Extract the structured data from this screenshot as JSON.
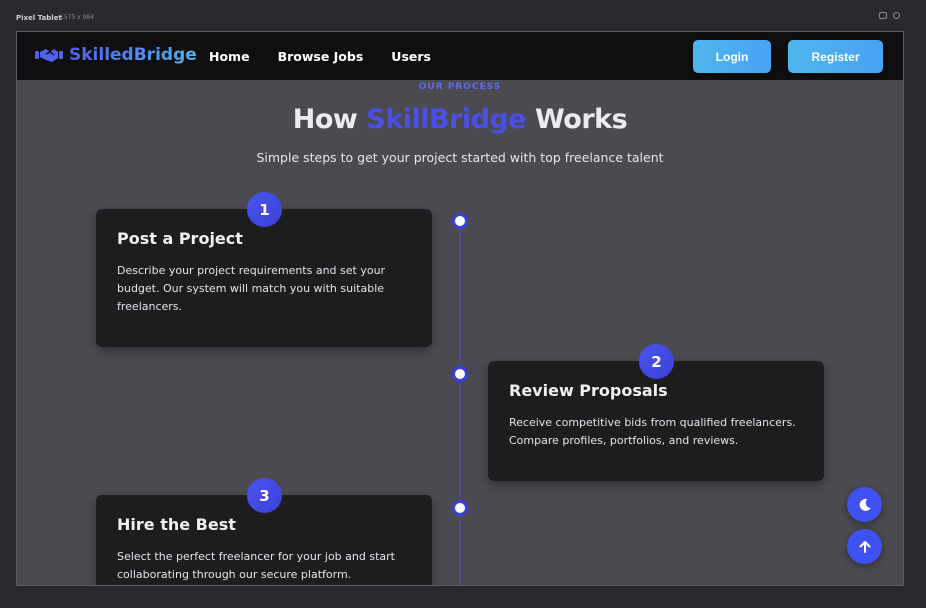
{
  "device": {
    "name": "Pixel Tablet",
    "dims": "1575 x 984"
  },
  "nav": {
    "logo_text": "SkilledBridge",
    "links": [
      "Home",
      "Browse Jobs",
      "Users"
    ],
    "login_label": "Login",
    "register_label": "Register"
  },
  "section": {
    "eyebrow": "OUR PROCESS",
    "title_prefix": "How",
    "title_accent": "SkillBridge",
    "title_suffix": "Works",
    "subtitle": "Simple steps to get your project started with top freelance talent"
  },
  "steps": [
    {
      "number": "1",
      "title": "Post a Project",
      "text": "Describe your project requirements and set your budget. Our system will match you with suitable freelancers."
    },
    {
      "number": "2",
      "title": "Review Proposals",
      "text": "Receive competitive bids from qualified freelancers. Compare profiles, portfolios, and reviews."
    },
    {
      "number": "3",
      "title": "Hire the Best",
      "text": "Select the perfect freelancer for your job and start collaborating through our secure platform."
    }
  ],
  "icons": {
    "logo": "handshake-icon",
    "theme_toggle": "moon-icon",
    "scroll_top": "arrow-up-icon"
  },
  "colors": {
    "accent": "#4a4fe6",
    "button": "#4fb6ec",
    "card": "#1d1d1f",
    "background": "#4b4a50"
  }
}
